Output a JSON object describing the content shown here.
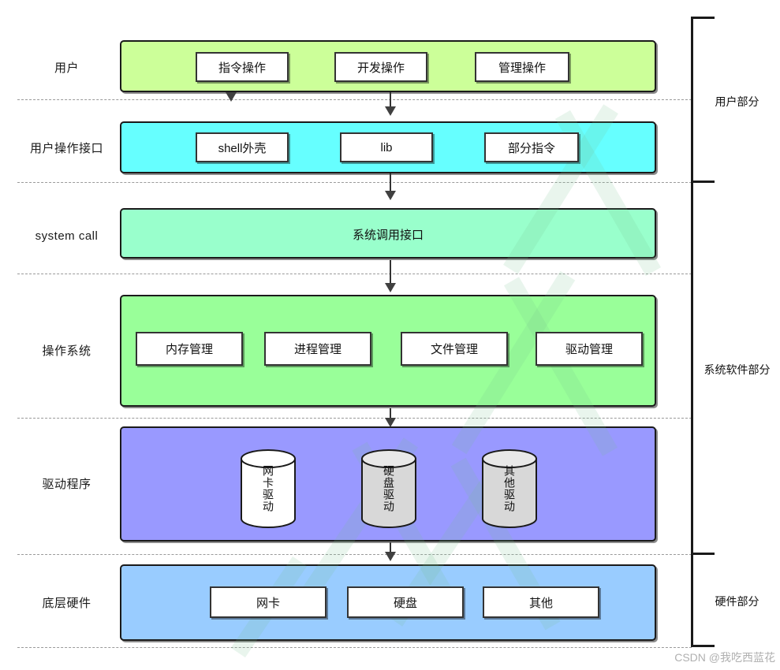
{
  "diagram": {
    "title": "Linux system layered architecture diagram",
    "layers": [
      {
        "id": "user",
        "label": "用户",
        "fill": "#ccff99",
        "nodes": [
          {
            "label": "指令操作"
          },
          {
            "label": "开发操作"
          },
          {
            "label": "管理操作"
          }
        ]
      },
      {
        "id": "user-interface",
        "label": "用户操作接口",
        "fill": "#66ffff",
        "nodes": [
          {
            "label": "shell外壳"
          },
          {
            "label": "lib"
          },
          {
            "label": "部分指令"
          }
        ]
      },
      {
        "id": "system-call",
        "label": "system call",
        "fill": "#99ffcc",
        "band_title": "系统调用接口",
        "nodes": []
      },
      {
        "id": "operating-system",
        "label": "操作系统",
        "fill": "#99ff99",
        "nodes": [
          {
            "label": "内存管理"
          },
          {
            "label": "进程管理"
          },
          {
            "label": "文件管理"
          },
          {
            "label": "驱动管理"
          }
        ]
      },
      {
        "id": "drivers",
        "label": "驱动程序",
        "fill": "#9999ff",
        "cylinders": [
          {
            "label": "网卡驱动",
            "fill": "#ffffff"
          },
          {
            "label": "硬盘驱动",
            "fill": "#d8d8d8"
          },
          {
            "label": "其他驱动",
            "fill": "#d8d8d8"
          }
        ]
      },
      {
        "id": "hardware",
        "label": "底层硬件",
        "fill": "#99ccff",
        "nodes": [
          {
            "label": "网卡"
          },
          {
            "label": "硬盘"
          },
          {
            "label": "其他"
          }
        ]
      }
    ],
    "brackets": [
      {
        "id": "user-part",
        "label": "用户部分"
      },
      {
        "id": "system-software-part",
        "label": "系统软件部分"
      },
      {
        "id": "hardware-part",
        "label": "硬件部分"
      }
    ],
    "watermark": "CSDN @我吃西蓝花"
  }
}
